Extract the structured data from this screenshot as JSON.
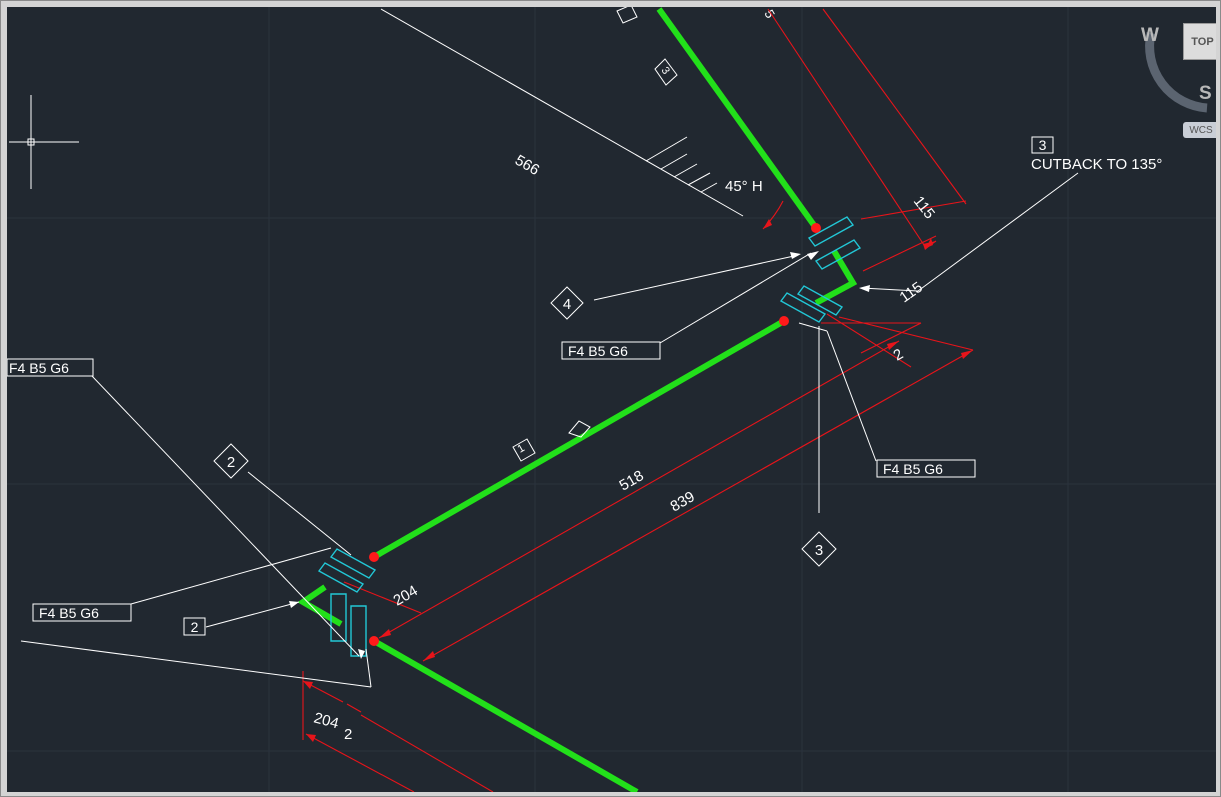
{
  "viewcube": {
    "west": "W",
    "south": "S",
    "top": "TOP",
    "wcs": "WCS"
  },
  "annotations": {
    "dim_566": "566",
    "angle": "45° H",
    "cutback_num": "3",
    "cutback_text": "CUTBACK TO 135°",
    "dim_115_a": "115",
    "dim_115_b": "115",
    "dim_2_right": "2",
    "dim_518": "518",
    "dim_839": "839",
    "dim_204_mid": "204",
    "dim_204_low": "204",
    "dim_2_low": "2",
    "pipe_tag_1": "1",
    "pipe_tag_3": "3",
    "bubble_4": "4",
    "bubble_2": "2",
    "bubble_3": "3",
    "box_2": "2",
    "flange_label_top_left": "F4  B5  G6",
    "flange_label_upper_right": "F4  B5  G6",
    "flange_label_right": "F4  B5  G6",
    "flange_label_bottom_left": "F4  B5  G6",
    "sliver_top": "5"
  },
  "colors": {
    "background": "#212830",
    "pipe": "#22e01a",
    "dimension": "#e8141a",
    "flange": "#22c7d6",
    "weld": "#ff0000",
    "leader": "#ffffff"
  }
}
